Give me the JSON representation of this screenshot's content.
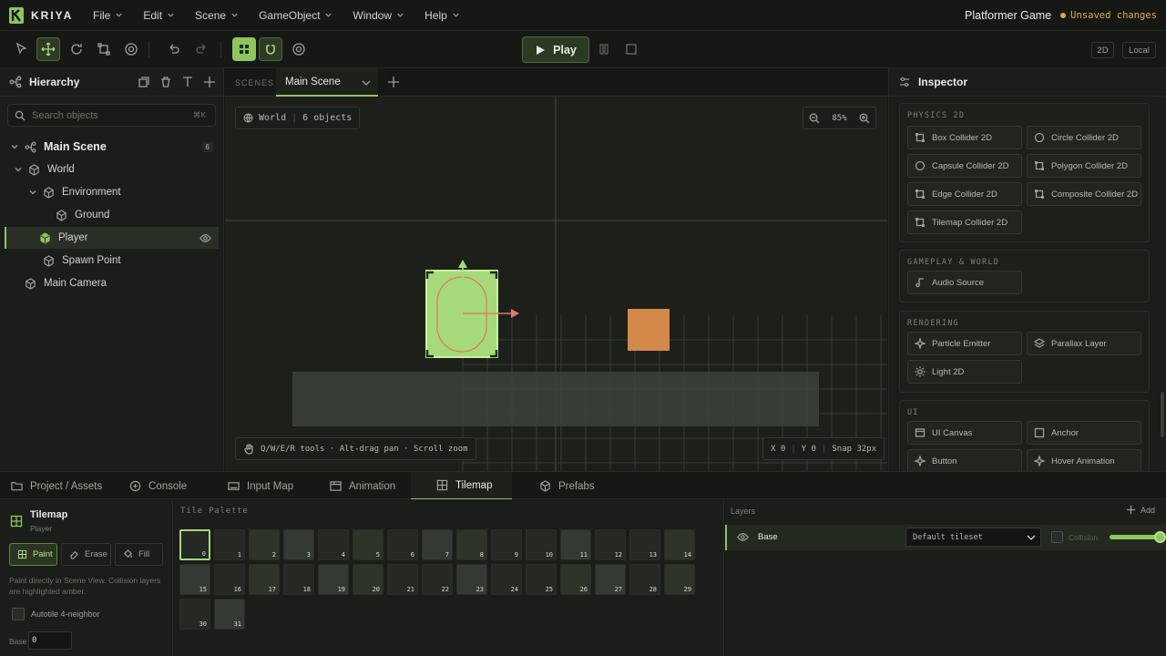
{
  "app": {
    "name": "KRIYA"
  },
  "menu": [
    "File",
    "Edit",
    "Scene",
    "GameObject",
    "Window",
    "Help"
  ],
  "project": {
    "title": "Platformer Game",
    "status": "Unsaved changes"
  },
  "toolbar": {
    "play_label": "Play",
    "mode_2d": "2D",
    "space": "Local"
  },
  "hierarchy": {
    "title": "Hierarchy",
    "search_placeholder": "Search objects",
    "search_shortcut": "⌘K",
    "scene_name": "Main Scene",
    "scene_count": "6",
    "items": [
      {
        "label": "World"
      },
      {
        "label": "Environment"
      },
      {
        "label": "Ground"
      },
      {
        "label": "Player"
      },
      {
        "label": "Spawn Point"
      },
      {
        "label": "Main Camera"
      }
    ]
  },
  "scene_tabs": {
    "label": "SCENES",
    "active": "Main Scene"
  },
  "viewport": {
    "world_label": "World",
    "object_count": "6 objects",
    "zoom": "85%",
    "hint": "Q/W/E/R tools · Alt-drag pan · Scroll zoom",
    "coord_x": "X 0",
    "coord_y": "Y 0",
    "snap": "Snap 32px"
  },
  "inspector": {
    "title": "Inspector",
    "sections": [
      {
        "label": "PHYSICS 2D",
        "items": [
          "Box Collider 2D",
          "Circle Collider 2D",
          "Capsule Collider 2D",
          "Polygon Collider 2D",
          "Edge Collider 2D",
          "Composite Collider 2D",
          "Tilemap Collider 2D"
        ]
      },
      {
        "label": "GAMEPLAY & WORLD",
        "items": [
          "Audio Source"
        ]
      },
      {
        "label": "RENDERING",
        "items": [
          "Particle Emitter",
          "Parallax Layer",
          "Light 2D"
        ]
      },
      {
        "label": "UI",
        "items": [
          "UI Canvas",
          "Anchor",
          "Button",
          "Hover Animation"
        ]
      }
    ]
  },
  "bottom_tabs": [
    "Project / Assets",
    "Console",
    "Input Map",
    "Animation",
    "Tilemap",
    "Prefabs"
  ],
  "tilemap": {
    "title": "Tilemap",
    "subtitle": "Player",
    "tools": [
      "Paint",
      "Erase",
      "Fill"
    ],
    "hint": "Paint directly in Scene View. Collision layers are highlighted amber.",
    "autotile_label": "Autotile 4-neighbor",
    "base_label": "Base",
    "base_value": "0",
    "palette_label": "Tile Palette",
    "tiles": [
      "0",
      "1",
      "2",
      "3",
      "4",
      "5",
      "6",
      "7",
      "8",
      "9",
      "10",
      "11",
      "12",
      "13",
      "14",
      "15",
      "16",
      "17",
      "18",
      "19",
      "20",
      "21",
      "22",
      "23",
      "24",
      "25",
      "26",
      "27",
      "28",
      "29",
      "30",
      "31"
    ]
  },
  "layers": {
    "title": "Layers",
    "add_label": "Add",
    "row": {
      "name": "Base",
      "tileset": "Default tileset",
      "collision_label": "Collision",
      "opacity": 1.0
    }
  },
  "colors": {
    "accent": "#8cc65c",
    "warning": "#e0a84a",
    "block": "#d4894a"
  }
}
